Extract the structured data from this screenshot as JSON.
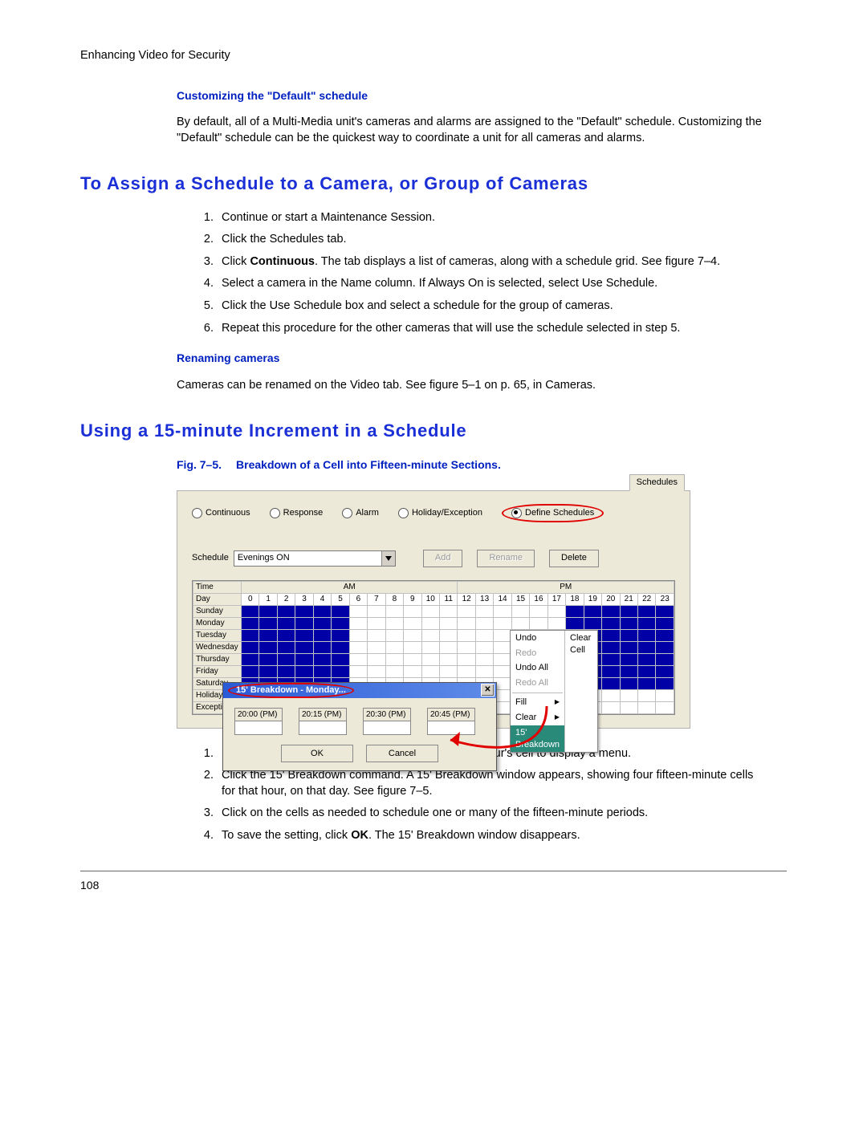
{
  "breadcrumb": "Enhancing Video for Security",
  "sec_customize": {
    "heading": "Customizing the \"Default\" schedule",
    "body": "By default, all of a Multi-Media unit's cameras and alarms are assigned to the \"Default\" schedule. Customizing the \"Default\" schedule can be the quickest way to coordinate a unit for all cameras and alarms."
  },
  "sec_assign": {
    "title": "To Assign a Schedule to a Camera, or Group of Cameras",
    "steps": [
      "Continue or start a Maintenance Session.",
      "Click the Schedules tab.",
      "",
      "Select a camera in the Name column. If Always On is selected, select Use Schedule.",
      "Click the Use Schedule box and select a schedule for the group of cameras.",
      "Repeat this procedure for the other cameras that will use the schedule selected in step 5."
    ],
    "step3_pre": "Click ",
    "step3_bold": "Continuous",
    "step3_post": ". The tab displays a list of cameras, along with a schedule grid. See figure 7–4."
  },
  "sec_rename": {
    "heading": "Renaming cameras",
    "body": "Cameras can be renamed on the Video tab. See figure 5–1 on p. 65, in Cameras."
  },
  "sec_15": {
    "title": "Using a 15-minute Increment in a Schedule",
    "fig_label": "Fig. 7–5.",
    "fig_title": "Breakdown of a Cell into Fifteen-minute Sections.",
    "steps_pre": [
      "In the Time/Day grid, on a day's row, right-click an hour's cell to display a menu.",
      "Click the 15' Breakdown command. A 15' Breakdown window appears, showing four fifteen-minute cells for that hour, on that day. See figure 7–5.",
      "Click on the cells as needed to schedule one or many of the fifteen-minute periods."
    ],
    "step4_pre": "To save the setting, click ",
    "step4_bold": "OK",
    "step4_post": ". The 15' Breakdown window disappears."
  },
  "panel": {
    "tab_label": "Schedules",
    "radios": [
      "Continuous",
      "Response",
      "Alarm",
      "Holiday/Exception",
      "Define Schedules"
    ],
    "schedule_label": "Schedule",
    "schedule_value": "Evenings ON",
    "btns": {
      "add": "Add",
      "rename": "Rename",
      "delete": "Delete"
    },
    "grid_headers": {
      "time": "Time",
      "day": "Day",
      "am": "AM",
      "pm": "PM"
    },
    "hours": [
      "0",
      "1",
      "2",
      "3",
      "4",
      "5",
      "6",
      "7",
      "8",
      "9",
      "10",
      "11",
      "12",
      "13",
      "14",
      "15",
      "16",
      "17",
      "18",
      "19",
      "20",
      "21",
      "22",
      "23"
    ],
    "rows": [
      "Sunday",
      "Monday",
      "Tuesday",
      "Wednesday",
      "Thursday",
      "Friday",
      "Saturday",
      "Holiday",
      "Exception"
    ],
    "menu": {
      "undo": "Undo",
      "redo": "Redo",
      "undoall": "Undo All",
      "redoall": "Redo All",
      "fill": "Fill",
      "clear": "Clear",
      "breakdown": "15' Breakdown",
      "clearcell": "Clear Cell"
    },
    "breakdown_dlg": {
      "title": "15' Breakdown - Monday...",
      "q": [
        "20:00 (PM)",
        "20:15 (PM)",
        "20:30 (PM)",
        "20:45 (PM)"
      ],
      "ok": "OK",
      "cancel": "Cancel"
    }
  },
  "page_number": "108"
}
